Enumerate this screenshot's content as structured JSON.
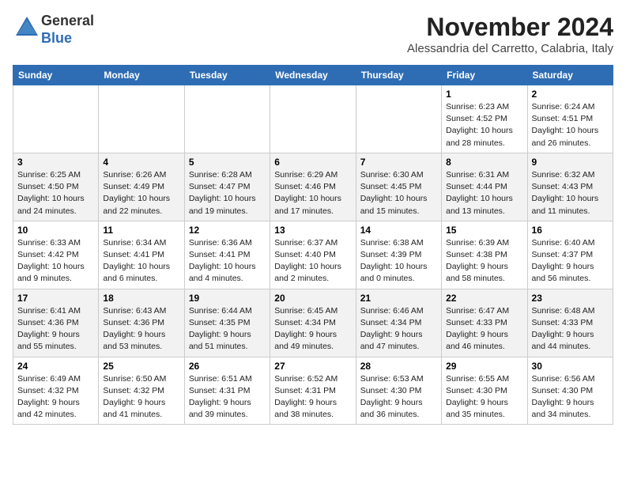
{
  "header": {
    "logo": {
      "line1": "General",
      "line2": "Blue"
    },
    "month": "November 2024",
    "location": "Alessandria del Carretto, Calabria, Italy"
  },
  "days_of_week": [
    "Sunday",
    "Monday",
    "Tuesday",
    "Wednesday",
    "Thursday",
    "Friday",
    "Saturday"
  ],
  "weeks": [
    [
      {
        "day": "",
        "info": ""
      },
      {
        "day": "",
        "info": ""
      },
      {
        "day": "",
        "info": ""
      },
      {
        "day": "",
        "info": ""
      },
      {
        "day": "",
        "info": ""
      },
      {
        "day": "1",
        "info": "Sunrise: 6:23 AM\nSunset: 4:52 PM\nDaylight: 10 hours and 28 minutes."
      },
      {
        "day": "2",
        "info": "Sunrise: 6:24 AM\nSunset: 4:51 PM\nDaylight: 10 hours and 26 minutes."
      }
    ],
    [
      {
        "day": "3",
        "info": "Sunrise: 6:25 AM\nSunset: 4:50 PM\nDaylight: 10 hours and 24 minutes."
      },
      {
        "day": "4",
        "info": "Sunrise: 6:26 AM\nSunset: 4:49 PM\nDaylight: 10 hours and 22 minutes."
      },
      {
        "day": "5",
        "info": "Sunrise: 6:28 AM\nSunset: 4:47 PM\nDaylight: 10 hours and 19 minutes."
      },
      {
        "day": "6",
        "info": "Sunrise: 6:29 AM\nSunset: 4:46 PM\nDaylight: 10 hours and 17 minutes."
      },
      {
        "day": "7",
        "info": "Sunrise: 6:30 AM\nSunset: 4:45 PM\nDaylight: 10 hours and 15 minutes."
      },
      {
        "day": "8",
        "info": "Sunrise: 6:31 AM\nSunset: 4:44 PM\nDaylight: 10 hours and 13 minutes."
      },
      {
        "day": "9",
        "info": "Sunrise: 6:32 AM\nSunset: 4:43 PM\nDaylight: 10 hours and 11 minutes."
      }
    ],
    [
      {
        "day": "10",
        "info": "Sunrise: 6:33 AM\nSunset: 4:42 PM\nDaylight: 10 hours and 9 minutes."
      },
      {
        "day": "11",
        "info": "Sunrise: 6:34 AM\nSunset: 4:41 PM\nDaylight: 10 hours and 6 minutes."
      },
      {
        "day": "12",
        "info": "Sunrise: 6:36 AM\nSunset: 4:41 PM\nDaylight: 10 hours and 4 minutes."
      },
      {
        "day": "13",
        "info": "Sunrise: 6:37 AM\nSunset: 4:40 PM\nDaylight: 10 hours and 2 minutes."
      },
      {
        "day": "14",
        "info": "Sunrise: 6:38 AM\nSunset: 4:39 PM\nDaylight: 10 hours and 0 minutes."
      },
      {
        "day": "15",
        "info": "Sunrise: 6:39 AM\nSunset: 4:38 PM\nDaylight: 9 hours and 58 minutes."
      },
      {
        "day": "16",
        "info": "Sunrise: 6:40 AM\nSunset: 4:37 PM\nDaylight: 9 hours and 56 minutes."
      }
    ],
    [
      {
        "day": "17",
        "info": "Sunrise: 6:41 AM\nSunset: 4:36 PM\nDaylight: 9 hours and 55 minutes."
      },
      {
        "day": "18",
        "info": "Sunrise: 6:43 AM\nSunset: 4:36 PM\nDaylight: 9 hours and 53 minutes."
      },
      {
        "day": "19",
        "info": "Sunrise: 6:44 AM\nSunset: 4:35 PM\nDaylight: 9 hours and 51 minutes."
      },
      {
        "day": "20",
        "info": "Sunrise: 6:45 AM\nSunset: 4:34 PM\nDaylight: 9 hours and 49 minutes."
      },
      {
        "day": "21",
        "info": "Sunrise: 6:46 AM\nSunset: 4:34 PM\nDaylight: 9 hours and 47 minutes."
      },
      {
        "day": "22",
        "info": "Sunrise: 6:47 AM\nSunset: 4:33 PM\nDaylight: 9 hours and 46 minutes."
      },
      {
        "day": "23",
        "info": "Sunrise: 6:48 AM\nSunset: 4:33 PM\nDaylight: 9 hours and 44 minutes."
      }
    ],
    [
      {
        "day": "24",
        "info": "Sunrise: 6:49 AM\nSunset: 4:32 PM\nDaylight: 9 hours and 42 minutes."
      },
      {
        "day": "25",
        "info": "Sunrise: 6:50 AM\nSunset: 4:32 PM\nDaylight: 9 hours and 41 minutes."
      },
      {
        "day": "26",
        "info": "Sunrise: 6:51 AM\nSunset: 4:31 PM\nDaylight: 9 hours and 39 minutes."
      },
      {
        "day": "27",
        "info": "Sunrise: 6:52 AM\nSunset: 4:31 PM\nDaylight: 9 hours and 38 minutes."
      },
      {
        "day": "28",
        "info": "Sunrise: 6:53 AM\nSunset: 4:30 PM\nDaylight: 9 hours and 36 minutes."
      },
      {
        "day": "29",
        "info": "Sunrise: 6:55 AM\nSunset: 4:30 PM\nDaylight: 9 hours and 35 minutes."
      },
      {
        "day": "30",
        "info": "Sunrise: 6:56 AM\nSunset: 4:30 PM\nDaylight: 9 hours and 34 minutes."
      }
    ]
  ]
}
